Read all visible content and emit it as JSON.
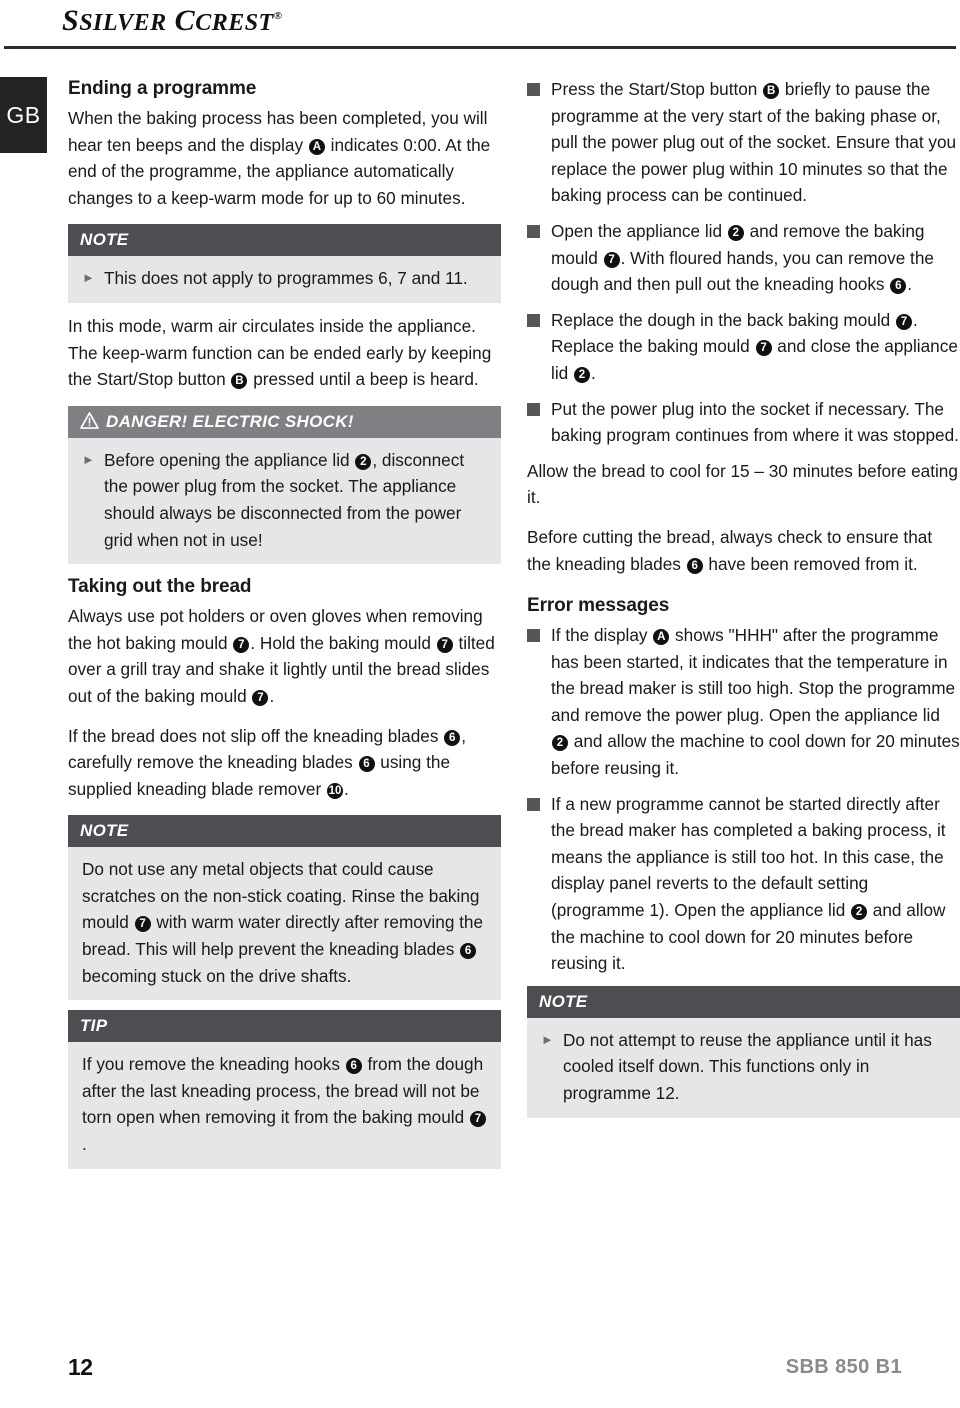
{
  "header": {
    "brand_silver": "SILVER",
    "brand_crest": "CREST",
    "registered_mark": "®"
  },
  "country_tab": {
    "label": "GB"
  },
  "footer": {
    "page_number": "12",
    "model": "SBB 850 B1"
  },
  "colors": {
    "note_header": "#4e4e52",
    "danger_header": "#808084",
    "callout_body": "#e6e6e8",
    "bullet_square": "#56565a",
    "country_tab": "#232326",
    "model_text": "#8a8a8e"
  },
  "left_column": {
    "heading_ending": "Ending a programme",
    "para_1_a": "When the baking process has been completed, you will hear ten beeps and the display ",
    "para_1_ref": "A",
    "para_1_b": " indicates 0:00. At the end of the programme, the appliance automatically changes to a keep-warm mode for up to 60 minutes.",
    "note1": {
      "title": "NOTE",
      "item": "This does not apply to programmes 6, 7 and 11."
    },
    "para_2_a": "In this mode, warm air circulates inside the appliance. The keep-warm function can be ended early by keeping the Start/Stop button ",
    "para_2_ref": "B",
    "para_2_b": " pressed until a beep is heard.",
    "danger": {
      "title": "DANGER! ELECTRIC SHOCK!",
      "icon": "warning-triangle-icon",
      "item_a": "Before opening the appliance lid ",
      "item_ref": "2",
      "item_b": ", disconnect the power plug from the socket. The appliance should always be disconnected from the power grid when not in use!"
    },
    "heading_taking_out": "Taking out the bread",
    "para_3_a": "Always use pot holders or oven gloves when removing the hot baking mould ",
    "para_3_ref1": "7",
    "para_3_b": ". Hold the baking mould ",
    "para_3_ref2": "7",
    "para_3_c": " tilted over a grill tray and shake it lightly until the bread slides out of the baking mould ",
    "para_3_ref3": "7",
    "para_3_d": ".",
    "para_4_a": "If the bread does not slip off the kneading blades ",
    "para_4_ref1": "6",
    "para_4_b": ", carefully remove the kneading blades ",
    "para_4_ref2": "6",
    "para_4_c": " using the supplied kneading blade remover ",
    "para_4_ref3": "10",
    "para_4_d": ".",
    "note2": {
      "title": "NOTE",
      "text_a": "Do not use any metal objects that could cause scratches on the non-stick coating. Rinse the baking mould ",
      "ref1": "7",
      "text_b": " with warm water directly after removing the bread. This will help prevent the kneading blades ",
      "ref2": "6",
      "text_c": " becoming stuck on the drive shafts."
    },
    "tip": {
      "title": "TIP",
      "text_a": "If you remove the kneading hooks ",
      "ref1": "6",
      "text_b": " from the dough after the last kneading process, the bread will not be torn open when removing it from the baking mould ",
      "ref2": "7",
      "text_c": "."
    }
  },
  "right_column": {
    "bullets_top": [
      {
        "text_a": "Press the Start/Stop button ",
        "ref1": "B",
        "text_b": " briefly to pause the programme at the very start of the baking phase or, pull the power plug out of the socket. Ensure that you replace the power plug within 10 minutes so that the baking process can be continued.",
        "ref2": "",
        "text_c": ""
      },
      {
        "text_a": "Open the appliance lid ",
        "ref1": "2",
        "text_b": " and remove the baking mould ",
        "ref2": "7",
        "text_c": ". With floured hands, you can remove the dough and then pull out the kneading hooks ",
        "ref3": "6",
        "text_d": "."
      },
      {
        "text_a": "Replace the dough in the back baking mould ",
        "ref1": "7",
        "text_b": ". Replace the baking mould ",
        "ref2": "7",
        "text_c": " and close the appliance lid ",
        "ref3": "2",
        "text_d": "."
      },
      {
        "text_a": "Put the power plug into the socket if necessary. The baking program continues from where it was stopped.",
        "ref1": "",
        "text_b": "",
        "ref2": "",
        "text_c": ""
      }
    ],
    "para_cool": "Allow the bread to cool for 15 – 30 minutes before eating it.",
    "para_cut_a": "Before cutting the bread, always check to ensure that the kneading blades ",
    "para_cut_ref": "6",
    "para_cut_b": " have been removed from it.",
    "heading_errors": "Error messages",
    "bullets_errors": [
      {
        "text_a": "If the display ",
        "ref1": "A",
        "text_b": " shows \"HHH\" after the programme has been started, it indicates that the temperature in the bread maker is still too high. Stop the programme and remove the power plug. Open the appliance lid ",
        "ref2": "2",
        "text_c": " and allow the machine to cool down for 20 minutes before reusing it."
      },
      {
        "text_a": "If a new programme cannot be started directly after the bread maker has completed a baking process, it means the appliance is still too hot. In this case, the display panel reverts to the default setting (programme 1). Open the appliance lid ",
        "ref1": "2",
        "text_b": " and allow the machine to cool down for 20 minutes before reusing it.",
        "ref2": "",
        "text_c": ""
      }
    ],
    "note3": {
      "title": "NOTE",
      "item": "Do not attempt to reuse the appliance until it has cooled itself down. This functions only in programme 12."
    }
  }
}
